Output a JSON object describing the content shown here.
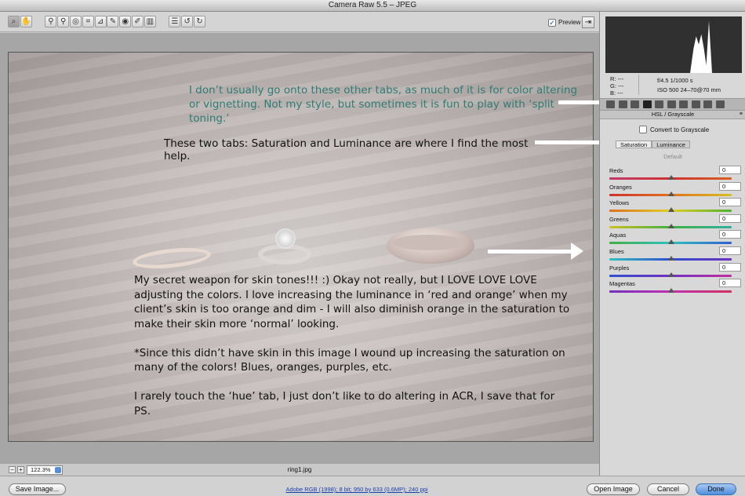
{
  "window": {
    "title": "Camera Raw 5.5  –  JPEG"
  },
  "toolbar": {
    "tools": [
      {
        "name": "zoom-tool-icon",
        "glyph": "⌕",
        "active": true
      },
      {
        "name": "hand-tool-icon",
        "glyph": "✋"
      },
      {
        "name": "white-balance-tool-icon",
        "glyph": "⚲"
      },
      {
        "name": "color-sampler-tool-icon",
        "glyph": "⚲"
      },
      {
        "name": "targeted-adjustment-tool-icon",
        "glyph": "◎"
      },
      {
        "name": "crop-tool-icon",
        "glyph": "⌗"
      },
      {
        "name": "straighten-tool-icon",
        "glyph": "⊿"
      },
      {
        "name": "spot-removal-tool-icon",
        "glyph": "✎"
      },
      {
        "name": "red-eye-tool-icon",
        "glyph": "◉"
      },
      {
        "name": "adjustment-brush-icon",
        "glyph": "✐"
      },
      {
        "name": "graduated-filter-icon",
        "glyph": "▥"
      },
      {
        "name": "preferences-icon",
        "glyph": "☰"
      },
      {
        "name": "rotate-left-icon",
        "glyph": "↺"
      },
      {
        "name": "rotate-right-icon",
        "glyph": "↻"
      }
    ],
    "preview_label": "Preview",
    "preview_checked": true
  },
  "image": {
    "teal_caption": "I don’t usually go onto these other tabs, as much of it is for color altering or vignetting.  Not my style, but sometimes it is fun to play with ‘split toning.’",
    "tabs_caption": "These two tabs:  Saturation and Luminance are where I find the most help.",
    "body_paragraphs": [
      "My secret weapon for skin tones!!! :)  Okay not really, but I LOVE LOVE LOVE adjusting the colors.  I love increasing the luminance in ‘red and orange’ when my client’s skin is too orange and dim - I will also diminish orange in the saturation to make their skin more ‘normal’ looking.",
      "*Since this didn’t have skin in this image I wound up increasing the saturation on many of the colors!  Blues, oranges, purples, etc.",
      "I rarely touch the ‘hue’ tab, I just don’t like to do altering in ACR, I save that for PS."
    ]
  },
  "statusbar": {
    "zoom": "122.3%",
    "filename": "ring1.jpg"
  },
  "panel": {
    "rgb_readout": [
      "R:  ---",
      "G:  ---",
      "B:  ---"
    ],
    "exif_line1": "f/4.5    1/1000 s",
    "exif_line2": "ISO 500    24–70@70 mm",
    "header": "HSL / Grayscale",
    "convert_label": "Convert to Grayscale",
    "subtabs": [
      "Saturation",
      "Luminance"
    ],
    "default_label": "Default",
    "sliders": [
      {
        "label": "Reds",
        "value": "0",
        "position": 0.5,
        "gradient": "linear-gradient(90deg,#c23a6a,#d23030,#d86020)"
      },
      {
        "label": "Oranges",
        "value": "0",
        "position": 0.5,
        "gradient": "linear-gradient(90deg,#d03030,#e07020,#d8c020)"
      },
      {
        "label": "Yellows",
        "value": "0",
        "position": 0.5,
        "gradient": "linear-gradient(90deg,#e07020,#e0d020,#50b030)"
      },
      {
        "label": "Greens",
        "value": "0",
        "position": 0.5,
        "gradient": "linear-gradient(90deg,#d0c020,#40b040,#30b0a0)"
      },
      {
        "label": "Aquas",
        "value": "0",
        "position": 0.5,
        "gradient": "linear-gradient(90deg,#40b040,#30c0c0,#3060d0)"
      },
      {
        "label": "Blues",
        "value": "0",
        "position": 0.5,
        "gradient": "linear-gradient(90deg,#30c0c0,#3050d0,#7030c0)"
      },
      {
        "label": "Purples",
        "value": "0",
        "position": 0.5,
        "gradient": "linear-gradient(90deg,#3050d0,#7030c0,#c030a0)"
      },
      {
        "label": "Magentas",
        "value": "0",
        "position": 0.5,
        "gradient": "linear-gradient(90deg,#7030c0,#c030b0,#d03060)"
      }
    ]
  },
  "bottombar": {
    "save_label": "Save Image...",
    "workflow_link": "Adobe RGB (1998); 8 bit; 950 by 633 (0.6MP); 240 ppi",
    "open_label": "Open Image",
    "cancel_label": "Cancel",
    "done_label": "Done"
  },
  "colors": {
    "caption_teal": "#2e7d74",
    "done_button": "#4f8ede",
    "link_blue": "#1b3fb0"
  }
}
